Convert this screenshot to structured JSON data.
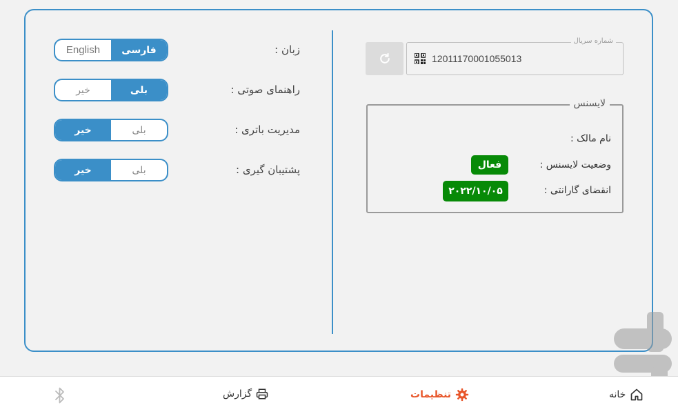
{
  "settings": {
    "language": {
      "label": "زبان :",
      "option_left": "English",
      "option_right": "فارسی",
      "selected": "فارسی"
    },
    "voice_guide": {
      "label": "راهنمای صوتی :",
      "option_left": "خیر",
      "option_right": "بلی",
      "selected": "بلی"
    },
    "battery_management": {
      "label": "مدیریت باتری :",
      "option_left": "خیر",
      "option_right": "بلی",
      "selected": "خیر"
    },
    "backup": {
      "label": "پشتیبان گیری :",
      "option_left": "خیر",
      "option_right": "بلی",
      "selected": "خیر"
    }
  },
  "serial": {
    "legend": "شماره سریال",
    "value": "12011170001055013",
    "refresh_icon": "refresh-icon",
    "qr_icon": "qr-code-icon"
  },
  "license": {
    "legend": "لایسنس",
    "owner_label": "نام مالک :",
    "owner_value": "",
    "status_label": "وضعیت لایسنس :",
    "status_value": "فعال",
    "warranty_label": "انقضای گارانتی :",
    "warranty_value": "۲۰۲۲/۱۰/۰۵",
    "badge_color": "#078a07"
  },
  "nav": {
    "home_label": "خانه",
    "settings_label": "تنظیمات",
    "report_label": "گزارش",
    "active": "settings",
    "accent": "#e8562a"
  },
  "colors": {
    "primary": "#3b8fc8"
  }
}
